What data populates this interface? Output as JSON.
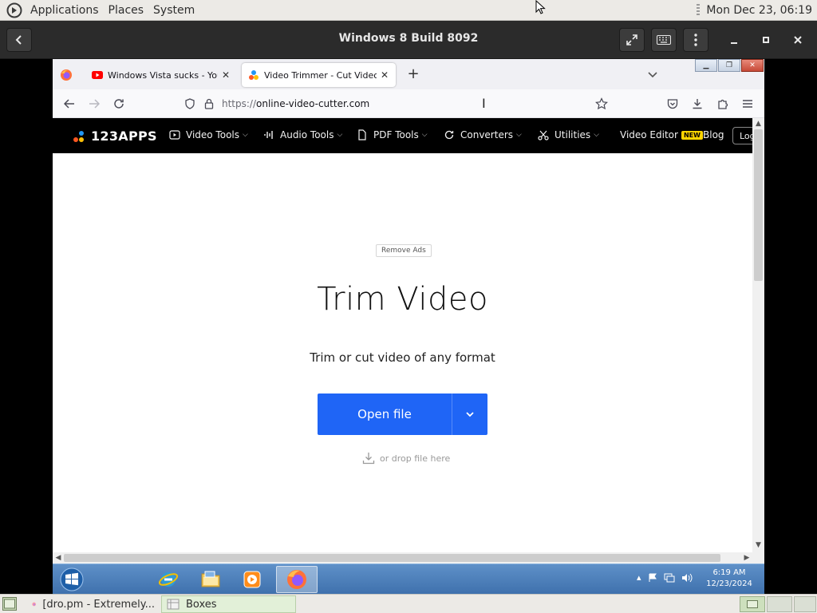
{
  "gnome_panel": {
    "menus": [
      "Applications",
      "Places",
      "System"
    ],
    "clock": "Mon Dec 23, 06:19"
  },
  "boxes": {
    "title": "Windows 8 Build 8092",
    "icons": [
      "back-arrow-icon",
      "fullscreen-icon",
      "keyboard-icon",
      "kebab-menu-icon",
      "minimize-icon",
      "maximize-icon",
      "close-icon"
    ]
  },
  "firefox": {
    "tabs": [
      {
        "title": "Windows Vista sucks - YouTube",
        "icon": "youtube-icon",
        "active": false
      },
      {
        "title": "Video Trimmer - Cut Video Onl",
        "icon": "123apps-icon",
        "active": true
      }
    ],
    "url": {
      "prefix": "https://",
      "host": "online-video-cutter.com"
    }
  },
  "site": {
    "logo": "123APPS",
    "menu": [
      {
        "label": "Video Tools",
        "icon": "play-icon"
      },
      {
        "label": "Audio Tools",
        "icon": "audio-wave-icon"
      },
      {
        "label": "PDF Tools",
        "icon": "document-icon"
      },
      {
        "label": "Converters",
        "icon": "refresh-icon"
      },
      {
        "label": "Utilities",
        "icon": "scissors-icon"
      }
    ],
    "video_editor": "Video Editor",
    "new_badge": "NEW",
    "blog": "Blog",
    "login": "Log",
    "remove_ads": "Remove Ads",
    "hero_title": "Trim Video",
    "hero_subtitle": "Trim or cut video of any format",
    "open_file": "Open file",
    "drop_hint": "or drop file here"
  },
  "win_taskbar": {
    "time": "6:19 AM",
    "date": "12/23/2024",
    "apps": [
      "internet-explorer-icon",
      "file-explorer-icon",
      "media-player-icon",
      "firefox-icon"
    ]
  },
  "gnome_bottom": {
    "windows": [
      {
        "title": "[dro.pm - Extremely...",
        "active": false
      },
      {
        "title": "Boxes",
        "active": true
      }
    ]
  },
  "colors": {
    "open_file_button": "#1f65f6",
    "site_nav": "#000000",
    "win_taskbar": "#4f80bb",
    "new_badge": "#ffd500"
  }
}
